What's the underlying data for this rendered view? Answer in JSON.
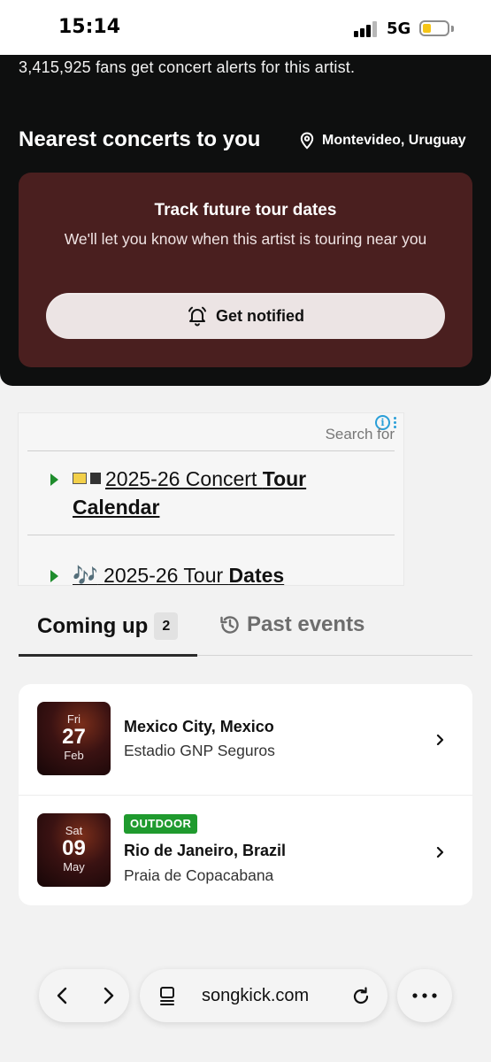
{
  "status_bar": {
    "time": "15:14",
    "network": "5G",
    "battery_level": 0.2
  },
  "artist": {
    "fans_text": "3,415,925 fans get concert alerts for this artist."
  },
  "nearest": {
    "title": "Nearest concerts to you",
    "location": "Montevideo, Uruguay",
    "track_card": {
      "title": "Track future tour dates",
      "subtitle": "We'll let you know when this artist is touring near you",
      "button_label": "Get notified"
    }
  },
  "ad": {
    "search_text": "Search for",
    "info_label": "i",
    "links": [
      {
        "emoji": "🎵",
        "prefix": "2025-26 Concert ",
        "bold": "Tour Calendar"
      },
      {
        "emoji": "🎶",
        "prefix": "2025-26 Tour ",
        "bold": "Dates"
      }
    ]
  },
  "tabs": {
    "coming_up_label": "Coming up",
    "coming_up_count": "2",
    "past_label": "Past events"
  },
  "events": [
    {
      "dow": "Fri",
      "day": "27",
      "month": "Feb",
      "badge": "",
      "city": "Mexico City, Mexico",
      "venue": "Estadio GNP Seguros"
    },
    {
      "dow": "Sat",
      "day": "09",
      "month": "May",
      "badge": "OUTDOOR",
      "city": "Rio de Janeiro, Brazil",
      "venue": "Praia de Copacabana"
    }
  ],
  "browser": {
    "url": "songkick.com"
  },
  "colors": {
    "dark_bg": "#0e0f0f",
    "card_bg": "#4a1f1f",
    "badge_green": "#1f9a2e",
    "ad_arrow": "#1e8c2c"
  }
}
